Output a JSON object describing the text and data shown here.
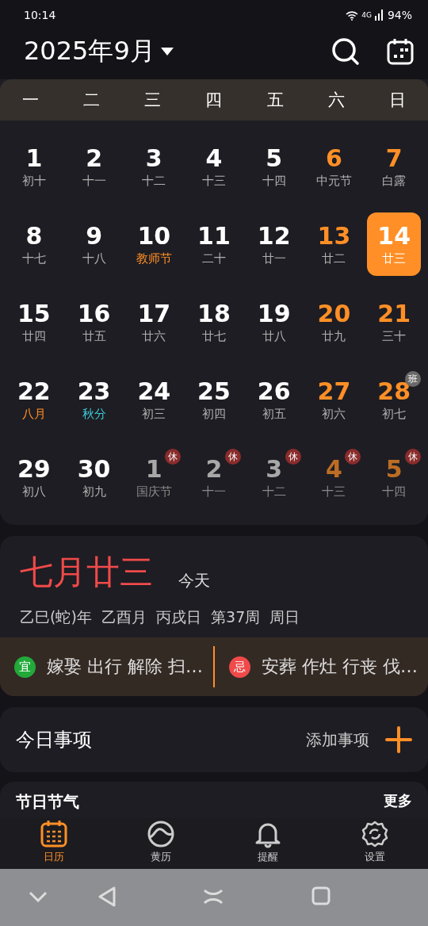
{
  "status_bar": {
    "time": "10:14",
    "network": "4G",
    "battery": "94%"
  },
  "header": {
    "title": "2025年9月"
  },
  "weekdays": [
    "一",
    "二",
    "三",
    "四",
    "五",
    "六",
    "日"
  ],
  "days": [
    {
      "day": "1",
      "lunar": "初十",
      "kind": "plain",
      "weekend": false,
      "other_month": false,
      "selected": false
    },
    {
      "day": "2",
      "lunar": "十一",
      "kind": "plain",
      "weekend": false,
      "other_month": false,
      "selected": false
    },
    {
      "day": "3",
      "lunar": "十二",
      "kind": "plain",
      "weekend": false,
      "other_month": false,
      "selected": false
    },
    {
      "day": "4",
      "lunar": "十三",
      "kind": "plain",
      "weekend": false,
      "other_month": false,
      "selected": false
    },
    {
      "day": "5",
      "lunar": "十四",
      "kind": "plain",
      "weekend": false,
      "other_month": false,
      "selected": false
    },
    {
      "day": "6",
      "lunar": "中元节",
      "kind": "plain",
      "weekend": true,
      "other_month": false,
      "selected": false
    },
    {
      "day": "7",
      "lunar": "白露",
      "kind": "plain",
      "weekend": true,
      "other_month": false,
      "selected": false
    },
    {
      "day": "8",
      "lunar": "十七",
      "kind": "plain",
      "weekend": false,
      "other_month": false,
      "selected": false
    },
    {
      "day": "9",
      "lunar": "十八",
      "kind": "plain",
      "weekend": false,
      "other_month": false,
      "selected": false
    },
    {
      "day": "10",
      "lunar": "教师节",
      "kind": "festival",
      "weekend": false,
      "other_month": false,
      "selected": false
    },
    {
      "day": "11",
      "lunar": "二十",
      "kind": "plain",
      "weekend": false,
      "other_month": false,
      "selected": false
    },
    {
      "day": "12",
      "lunar": "廿一",
      "kind": "plain",
      "weekend": false,
      "other_month": false,
      "selected": false
    },
    {
      "day": "13",
      "lunar": "廿二",
      "kind": "plain",
      "weekend": true,
      "other_month": false,
      "selected": false
    },
    {
      "day": "14",
      "lunar": "廿三",
      "kind": "plain",
      "weekend": true,
      "other_month": false,
      "selected": true
    },
    {
      "day": "15",
      "lunar": "廿四",
      "kind": "plain",
      "weekend": false,
      "other_month": false,
      "selected": false
    },
    {
      "day": "16",
      "lunar": "廿五",
      "kind": "plain",
      "weekend": false,
      "other_month": false,
      "selected": false
    },
    {
      "day": "17",
      "lunar": "廿六",
      "kind": "plain",
      "weekend": false,
      "other_month": false,
      "selected": false
    },
    {
      "day": "18",
      "lunar": "廿七",
      "kind": "plain",
      "weekend": false,
      "other_month": false,
      "selected": false
    },
    {
      "day": "19",
      "lunar": "廿八",
      "kind": "plain",
      "weekend": false,
      "other_month": false,
      "selected": false
    },
    {
      "day": "20",
      "lunar": "廿九",
      "kind": "plain",
      "weekend": true,
      "other_month": false,
      "selected": false
    },
    {
      "day": "21",
      "lunar": "三十",
      "kind": "plain",
      "weekend": true,
      "other_month": false,
      "selected": false
    },
    {
      "day": "22",
      "lunar": "八月",
      "kind": "festival",
      "weekend": false,
      "other_month": false,
      "selected": false
    },
    {
      "day": "23",
      "lunar": "秋分",
      "kind": "term",
      "weekend": false,
      "other_month": false,
      "selected": false
    },
    {
      "day": "24",
      "lunar": "初三",
      "kind": "plain",
      "weekend": false,
      "other_month": false,
      "selected": false
    },
    {
      "day": "25",
      "lunar": "初四",
      "kind": "plain",
      "weekend": false,
      "other_month": false,
      "selected": false
    },
    {
      "day": "26",
      "lunar": "初五",
      "kind": "plain",
      "weekend": false,
      "other_month": false,
      "selected": false
    },
    {
      "day": "27",
      "lunar": "初六",
      "kind": "plain",
      "weekend": true,
      "other_month": false,
      "selected": false
    },
    {
      "day": "28",
      "lunar": "初七",
      "kind": "plain",
      "weekend": true,
      "other_month": false,
      "selected": false,
      "badge": "班",
      "badge_rest": false
    },
    {
      "day": "29",
      "lunar": "初八",
      "kind": "plain",
      "weekend": false,
      "other_month": false,
      "selected": false
    },
    {
      "day": "30",
      "lunar": "初九",
      "kind": "plain",
      "weekend": false,
      "other_month": false,
      "selected": false
    },
    {
      "day": "1",
      "lunar": "国庆节",
      "kind": "plain",
      "weekend": false,
      "other_month": true,
      "selected": false,
      "badge": "休",
      "badge_rest": true
    },
    {
      "day": "2",
      "lunar": "十一",
      "kind": "plain",
      "weekend": false,
      "other_month": true,
      "selected": false,
      "badge": "休",
      "badge_rest": true
    },
    {
      "day": "3",
      "lunar": "十二",
      "kind": "plain",
      "weekend": false,
      "other_month": true,
      "selected": false,
      "badge": "休",
      "badge_rest": true
    },
    {
      "day": "4",
      "lunar": "十三",
      "kind": "plain",
      "weekend": true,
      "other_month": true,
      "selected": false,
      "badge": "休",
      "badge_rest": true
    },
    {
      "day": "5",
      "lunar": "十四",
      "kind": "plain",
      "weekend": true,
      "other_month": true,
      "selected": false,
      "badge": "休",
      "badge_rest": true
    }
  ],
  "day_info": {
    "lunar_date": "七月廿三",
    "today_label": "今天",
    "ganzhi": "乙巳(蛇)年  乙酉月  丙戌日  第37周  周日",
    "almanac": [
      {
        "mark": "宜",
        "color": "#22a93a",
        "text": "嫁娶 出行 解除 扫…"
      },
      {
        "mark": "忌",
        "color": "#f04a4a",
        "text": "安葬 作灶 行丧 伐…"
      }
    ]
  },
  "today_events": {
    "title": "今日事项",
    "add_label": "添加事项"
  },
  "festivals": {
    "title": "节日节气",
    "more": "更多"
  },
  "tabs": [
    {
      "label": "日历",
      "selected": true
    },
    {
      "label": "黄历",
      "selected": false
    },
    {
      "label": "提醒",
      "selected": false
    },
    {
      "label": "设置",
      "selected": false
    }
  ]
}
